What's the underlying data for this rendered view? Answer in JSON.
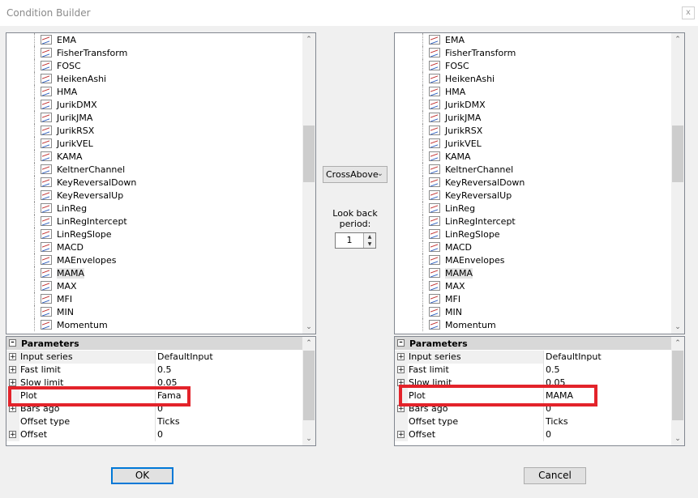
{
  "window": {
    "title": "Condition Builder",
    "close": "x"
  },
  "indicators": [
    "EMA",
    "FisherTransform",
    "FOSC",
    "HeikenAshi",
    "HMA",
    "JurikDMX",
    "JurikJMA",
    "JurikRSX",
    "JurikVEL",
    "KAMA",
    "KeltnerChannel",
    "KeyReversalDown",
    "KeyReversalUp",
    "LinReg",
    "LinRegIntercept",
    "LinRegSlope",
    "MACD",
    "MAEnvelopes",
    "MAMA",
    "MAX",
    "MFI",
    "MIN",
    "Momentum"
  ],
  "selected_indicator": "MAMA",
  "left_params": {
    "header": "Parameters",
    "rows": [
      {
        "name": "Input series",
        "value": "DefaultInput"
      },
      {
        "name": "Fast limit",
        "value": "0.5"
      },
      {
        "name": "Slow limit",
        "value": "0.05"
      },
      {
        "name": "Plot",
        "value": "Fama"
      },
      {
        "name": "Bars ago",
        "value": "0"
      },
      {
        "name": "Offset type",
        "value": "Ticks"
      },
      {
        "name": "Offset",
        "value": "0"
      }
    ]
  },
  "right_params": {
    "header": "Parameters",
    "rows": [
      {
        "name": "Input series",
        "value": "DefaultInput"
      },
      {
        "name": "Fast limit",
        "value": "0.5"
      },
      {
        "name": "Slow limit",
        "value": "0.05"
      },
      {
        "name": "Plot",
        "value": "MAMA"
      },
      {
        "name": "Bars ago",
        "value": "0"
      },
      {
        "name": "Offset type",
        "value": "Ticks"
      },
      {
        "name": "Offset",
        "value": "0"
      }
    ]
  },
  "condition": {
    "operator": "CrossAbove",
    "lookback_label": "Look back period:",
    "lookback_value": "1"
  },
  "buttons": {
    "ok": "OK",
    "cancel": "Cancel"
  },
  "colors": {
    "highlight": "#e3232a",
    "accent": "#0078d7"
  }
}
